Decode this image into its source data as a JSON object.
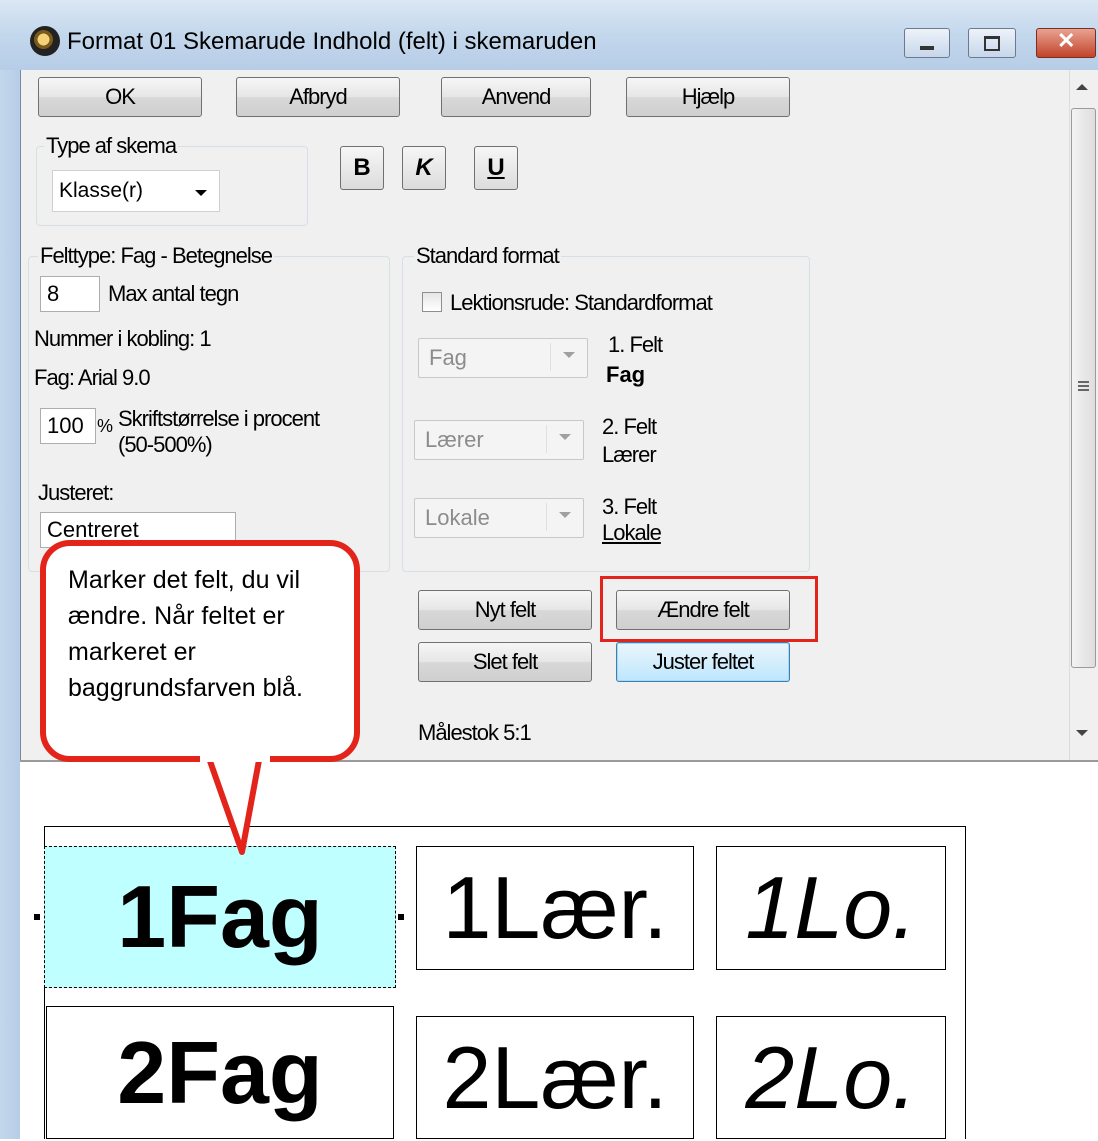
{
  "window": {
    "title": "Format 01  Skemarude  Indhold (felt) i skemaruden",
    "icon": "clock-icon",
    "controls": [
      "minimize-icon",
      "maximize-icon",
      "close-icon"
    ]
  },
  "toolbar": {
    "ok_label": "OK",
    "cancel_label": "Afbryd",
    "apply_label": "Anvend",
    "help_label": "Hjælp"
  },
  "schedule_type": {
    "legend": "Type af skema",
    "selected": "Klasse(r)"
  },
  "format_buttons": {
    "bold": "B",
    "italic": "K",
    "underline": "U"
  },
  "field_type": {
    "legend": "Felttype: Fag - Betegnelse",
    "max_chars_value": "8",
    "max_chars_label": "Max antal tegn",
    "link_number": "Nummer i kobling: 1",
    "font_info": "Fag: Arial 9.0",
    "font_size_value": "100",
    "percent_sign": "%",
    "font_size_label_1": "Skriftstørrelse i procent",
    "font_size_label_2": "(50-500%)",
    "align_label": "Justeret:",
    "align_value": "Centreret"
  },
  "standard_format": {
    "legend": "Standard format",
    "checkbox_label": "Lektionsrude: Standardformat",
    "checkbox_checked": false,
    "fields": [
      {
        "combo": "Fag",
        "caption": "1. Felt",
        "name": "Fag",
        "style": "bold"
      },
      {
        "combo": "Lærer",
        "caption": "2. Felt",
        "name": "Lærer",
        "style": "normal"
      },
      {
        "combo": "Lokale",
        "caption": "3. Felt",
        "name": "Lokale",
        "style": "underline"
      }
    ]
  },
  "field_actions": {
    "new_field": "Nyt felt",
    "change_field": "Ændre felt",
    "delete_field": "Slet felt",
    "adjust_field": "Juster feltet"
  },
  "scale": {
    "label": "Målestok  5:1"
  },
  "callout": {
    "text": "Marker det felt, du vil ændre. Når feltet er markeret er baggrundsfarven blå."
  },
  "preview": {
    "selected_color": "#c0ffff",
    "rows": [
      [
        "1Fag",
        "1Lær.",
        "1Lo."
      ],
      [
        "2Fag",
        "2Lær.",
        "2Lo."
      ]
    ]
  },
  "colors": {
    "callout_border": "#e3241b",
    "highlight_box": "#e3241b"
  }
}
